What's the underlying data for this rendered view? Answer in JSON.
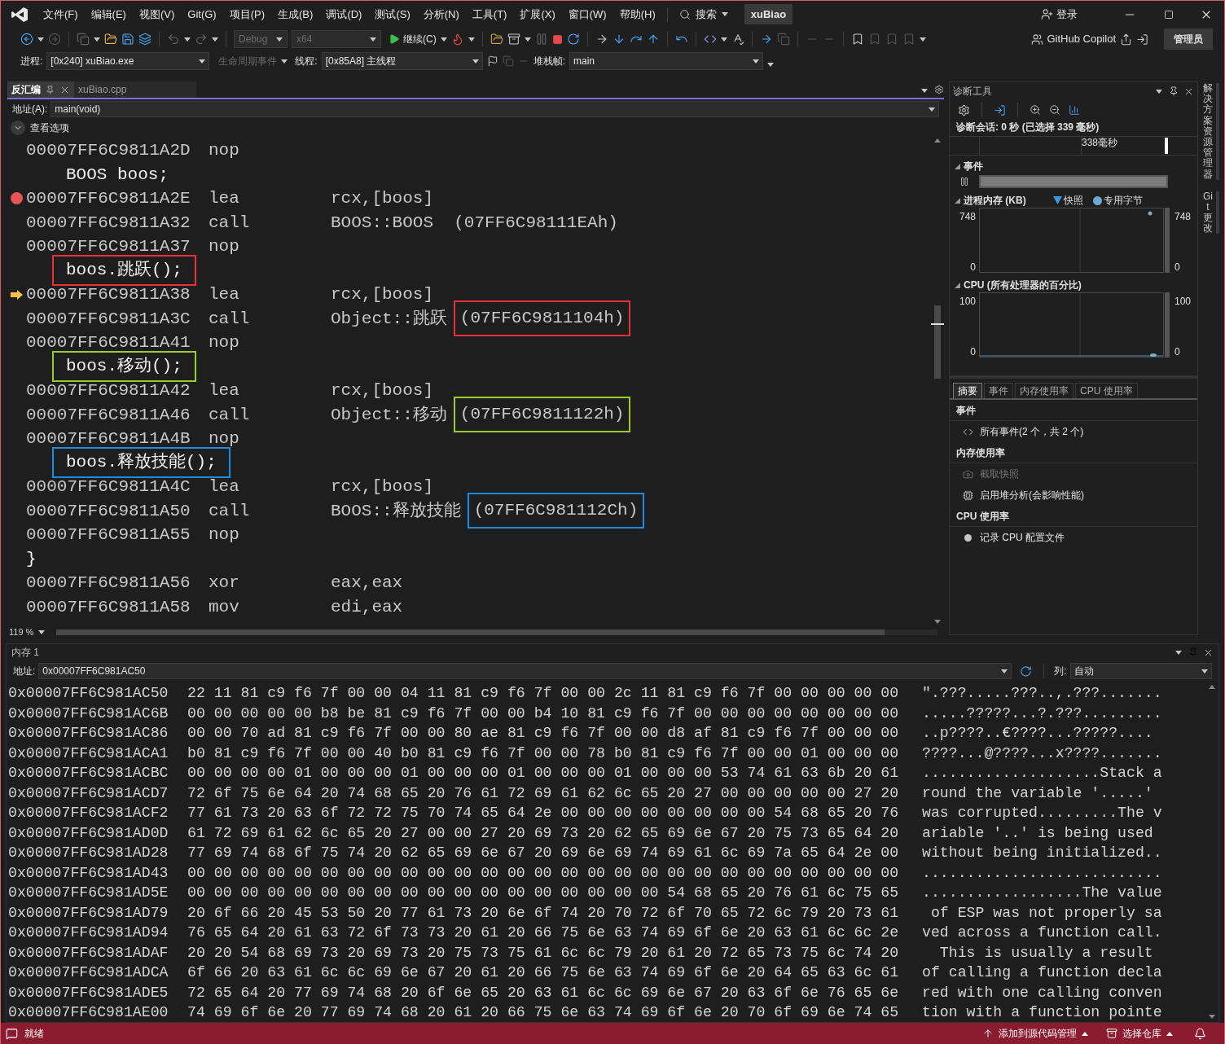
{
  "title_bar": {
    "menu": [
      "文件(F)",
      "编辑(E)",
      "视图(V)",
      "Git(G)",
      "项目(P)",
      "生成(B)",
      "调试(D)",
      "测试(S)",
      "分析(N)",
      "工具(T)",
      "扩展(X)",
      "窗口(W)",
      "帮助(H)"
    ],
    "search": "搜索",
    "solution": "xuBiao",
    "login": "登录"
  },
  "toolbar": {
    "configuration": {
      "value": "Debug",
      "disabled": true
    },
    "platform": {
      "value": "x64",
      "disabled": true
    },
    "continue": "继续(C)",
    "copilot": "GitHub Copilot",
    "admin": "管理员"
  },
  "debug_location": {
    "process_label": "进程:",
    "process": "[0x240] xuBiao.exe",
    "lifecycle": {
      "label": "生命周期事件",
      "disabled": true
    },
    "thread_label": "线程:",
    "thread": "[0x85A8] 主线程",
    "stack_label": "堆栈帧:",
    "stack": "main"
  },
  "document_tabs": [
    {
      "label": "反汇编",
      "selected": true
    },
    {
      "label": "xuBiao.cpp",
      "selected": false
    }
  ],
  "disassembly": {
    "address_label": "地址(A):",
    "address": "main(void)",
    "view_options": "查看选项",
    "zoom": "119 %",
    "lines": [
      {
        "kind": "asm",
        "address": "00007FF6C9811A2D",
        "op": "nop",
        "breakpoint": false,
        "current": false
      },
      {
        "kind": "source",
        "text": "BOOS boos;"
      },
      {
        "kind": "asm",
        "address": "00007FF6C9811A2E",
        "op": "lea",
        "operand": "rcx,[boos]",
        "breakpoint": true,
        "current": false
      },
      {
        "kind": "asm",
        "address": "00007FF6C9811A32",
        "op": "call",
        "operand": "BOOS::BOOS  (07FF6C98111EAh)",
        "breakpoint": false,
        "current": false
      },
      {
        "kind": "asm",
        "address": "00007FF6C9811A37",
        "op": "nop",
        "breakpoint": false,
        "current": false
      },
      {
        "kind": "source",
        "text": "boos.跳跃();",
        "color": "#e8313a"
      },
      {
        "kind": "asm",
        "address": "00007FF6C9811A38",
        "op": "lea",
        "operand": "rcx,[boos]",
        "breakpoint": false,
        "current": true
      },
      {
        "kind": "asm",
        "address": "00007FF6C9811A3C",
        "op": "call",
        "operand": "Object::跳跃",
        "target": "(07FF6C9811104h)",
        "color": "#e8313a",
        "breakpoint": false,
        "current": false
      },
      {
        "kind": "asm",
        "address": "00007FF6C9811A41",
        "op": "nop",
        "breakpoint": false,
        "current": false
      },
      {
        "kind": "source",
        "text": "boos.移动();",
        "color": "#9ccc2c"
      },
      {
        "kind": "asm",
        "address": "00007FF6C9811A42",
        "op": "lea",
        "operand": "rcx,[boos]",
        "breakpoint": false,
        "current": false
      },
      {
        "kind": "asm",
        "address": "00007FF6C9811A46",
        "op": "call",
        "operand": "Object::移动",
        "target": "(07FF6C9811122h)",
        "color": "#9ccc2c",
        "breakpoint": false,
        "current": false
      },
      {
        "kind": "asm",
        "address": "00007FF6C9811A4B",
        "op": "nop",
        "breakpoint": false,
        "current": false
      },
      {
        "kind": "source",
        "text": "boos.释放技能();",
        "color": "#1e8ae0"
      },
      {
        "kind": "asm",
        "address": "00007FF6C9811A4C",
        "op": "lea",
        "operand": "rcx,[boos]",
        "breakpoint": false,
        "current": false
      },
      {
        "kind": "asm",
        "address": "00007FF6C9811A50",
        "op": "call",
        "operand": "BOOS::释放技能",
        "target": "(07FF6C981112Ch)",
        "color": "#1e8ae0",
        "breakpoint": false,
        "current": false
      },
      {
        "kind": "asm",
        "address": "00007FF6C9811A55",
        "op": "nop",
        "breakpoint": false,
        "current": false
      },
      {
        "kind": "brace",
        "text": "}"
      },
      {
        "kind": "asm",
        "address": "00007FF6C9811A56",
        "op": "xor",
        "operand": "eax,eax",
        "breakpoint": false,
        "current": false
      },
      {
        "kind": "asm",
        "address": "00007FF6C9811A58",
        "op": "mov",
        "operand": "edi,eax",
        "breakpoint": false,
        "current": false
      }
    ]
  },
  "diagnostics": {
    "title": "诊断工具",
    "session": "诊断会话: 0 秒 (已选择 339 毫秒)",
    "timeline_label": "338毫秒",
    "events_label": "事件",
    "memory_chart": {
      "title": "进程内存 (KB)",
      "legend": [
        {
          "label": "快照",
          "kind": "triangle"
        },
        {
          "label": "专用字节",
          "kind": "circle"
        }
      ],
      "left_axis": {
        "max": "748",
        "min": "0"
      },
      "right_axis": {
        "max": "748",
        "min": "0"
      }
    },
    "cpu_chart": {
      "title": "CPU (所有处理器的百分比)",
      "left_axis": {
        "max": "100",
        "min": "0"
      },
      "right_axis": {
        "max": "100",
        "min": "0"
      }
    },
    "tabs": [
      {
        "label": "摘要",
        "selected": true
      },
      {
        "label": "事件",
        "selected": false
      },
      {
        "label": "内存使用率",
        "selected": false
      },
      {
        "label": "CPU 使用率",
        "selected": false
      }
    ],
    "sections": [
      {
        "heading": "事件",
        "items": [
          {
            "label": "所有事件(2 个，共 2 个)",
            "kind": "events",
            "disabled": false
          }
        ]
      },
      {
        "heading": "内存使用率",
        "items": [
          {
            "label": "截取快照",
            "kind": "camera",
            "disabled": true
          },
          {
            "label": "启用堆分析(会影响性能)",
            "kind": "heap",
            "disabled": false
          }
        ]
      },
      {
        "heading": "CPU 使用率",
        "items": [
          {
            "label": "记录 CPU 配置文件",
            "kind": "record",
            "disabled": false
          }
        ]
      }
    ]
  },
  "side_tabs": [
    "解决方案资源管理器",
    "Git 更改"
  ],
  "memory": {
    "title": "内存 1",
    "address_label": "地址:",
    "address": "0x00007FF6C981AC50",
    "columns_label": "列:",
    "columns": "自动",
    "rows": [
      {
        "address": "0x00007FF6C981AC50",
        "bytes": "22 11 81 c9 f6 7f 00 00 04 11 81 c9 f6 7f 00 00 2c 11 81 c9 f6 7f 00 00 00 00 00",
        "text": "\".???.....???..,.???......."
      },
      {
        "address": "0x00007FF6C981AC6B",
        "bytes": "00 00 00 00 00 b8 be 81 c9 f6 7f 00 00 b4 10 81 c9 f6 7f 00 00 00 00 00 00 00 00",
        "text": ".....?????...?.???........."
      },
      {
        "address": "0x00007FF6C981AC86",
        "bytes": "00 00 70 ad 81 c9 f6 7f 00 00 80 ae 81 c9 f6 7f 00 00 d8 af 81 c9 f6 7f 00 00 00",
        "text": "..p????..€????...?????...."
      },
      {
        "address": "0x00007FF6C981ACA1",
        "bytes": "b0 81 c9 f6 7f 00 00 40 b0 81 c9 f6 7f 00 00 78 b0 81 c9 f6 7f 00 00 01 00 00 00",
        "text": "????...@????...x????......."
      },
      {
        "address": "0x00007FF6C981ACBC",
        "bytes": "00 00 00 00 01 00 00 00 01 00 00 00 01 00 00 00 01 00 00 00 53 74 61 63 6b 20 61",
        "text": "....................Stack a"
      },
      {
        "address": "0x00007FF6C981ACD7",
        "bytes": "72 6f 75 6e 64 20 74 68 65 20 76 61 72 69 61 62 6c 65 20 27 00 00 00 00 00 27 20",
        "text": "round the variable '.....' "
      },
      {
        "address": "0x00007FF6C981ACF2",
        "bytes": "77 61 73 20 63 6f 72 72 75 70 74 65 64 2e 00 00 00 00 00 00 00 00 54 68 65 20 76",
        "text": "was corrupted.........The v"
      },
      {
        "address": "0x00007FF6C981AD0D",
        "bytes": "61 72 69 61 62 6c 65 20 27 00 00 27 20 69 73 20 62 65 69 6e 67 20 75 73 65 64 20",
        "text": "ariable '..' is being used "
      },
      {
        "address": "0x00007FF6C981AD28",
        "bytes": "77 69 74 68 6f 75 74 20 62 65 69 6e 67 20 69 6e 69 74 69 61 6c 69 7a 65 64 2e 00",
        "text": "without being initialized.."
      },
      {
        "address": "0x00007FF6C981AD43",
        "bytes": "00 00 00 00 00 00 00 00 00 00 00 00 00 00 00 00 00 00 00 00 00 00 00 00 00 00 00",
        "text": "..........................."
      },
      {
        "address": "0x00007FF6C981AD5E",
        "bytes": "00 00 00 00 00 00 00 00 00 00 00 00 00 00 00 00 00 00 54 68 65 20 76 61 6c 75 65",
        "text": "..................The value"
      },
      {
        "address": "0x00007FF6C981AD79",
        "bytes": "20 6f 66 20 45 53 50 20 77 61 73 20 6e 6f 74 20 70 72 6f 70 65 72 6c 79 20 73 61",
        "text": " of ESP was not properly sa"
      },
      {
        "address": "0x00007FF6C981AD94",
        "bytes": "76 65 64 20 61 63 72 6f 73 73 20 61 20 66 75 6e 63 74 69 6f 6e 20 63 61 6c 6c 2e",
        "text": "ved across a function call."
      },
      {
        "address": "0x00007FF6C981ADAF",
        "bytes": "20 20 54 68 69 73 20 69 73 20 75 73 75 61 6c 6c 79 20 61 20 72 65 73 75 6c 74 20",
        "text": "  This is usually a result "
      },
      {
        "address": "0x00007FF6C981ADCA",
        "bytes": "6f 66 20 63 61 6c 6c 69 6e 67 20 61 20 66 75 6e 63 74 69 6f 6e 20 64 65 63 6c 61",
        "text": "of calling a function decla"
      },
      {
        "address": "0x00007FF6C981ADE5",
        "bytes": "72 65 64 20 77 69 74 68 20 6f 6e 65 20 63 61 6c 6c 69 6e 67 20 63 6f 6e 76 65 6e",
        "text": "red with one calling conven"
      },
      {
        "address": "0x00007FF6C981AE00",
        "bytes": "74 69 6f 6e 20 77 69 74 68 20 61 20 66 75 6e 63 74 69 6f 6e 20 70 6f 69 6e 74 65",
        "text": "tion with a function pointe"
      }
    ]
  },
  "status_bar": {
    "status": "就绪",
    "source_control": "添加到源代码管理",
    "repository": "选择仓库"
  }
}
